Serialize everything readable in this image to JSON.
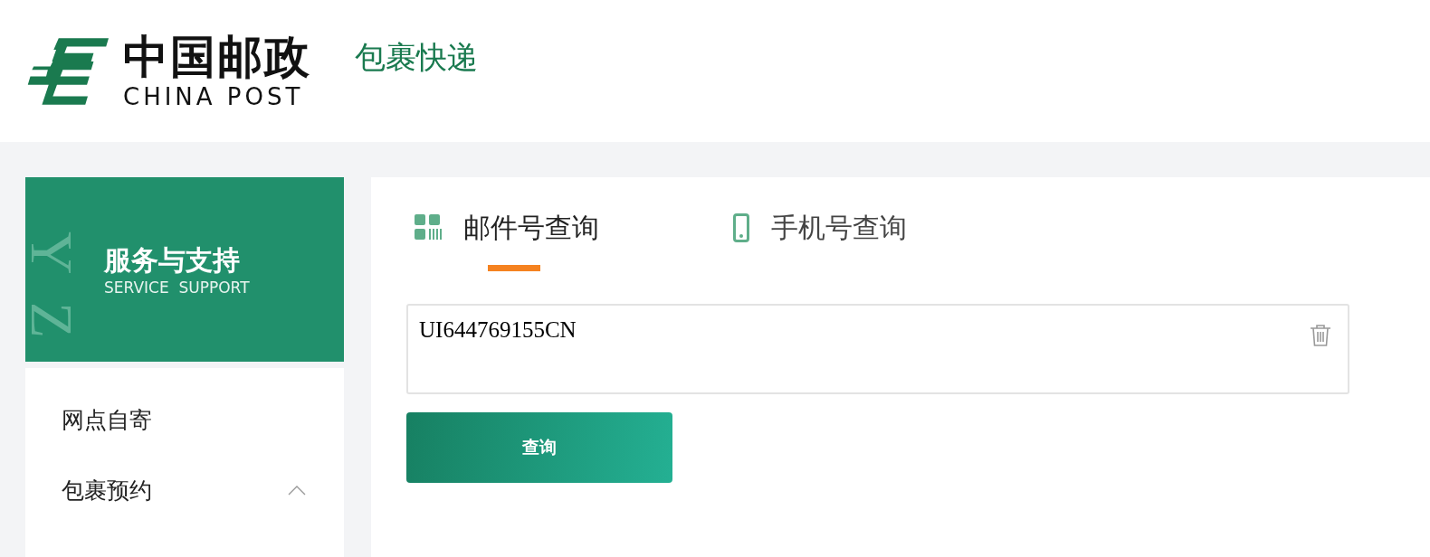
{
  "header": {
    "logo_cn": "中国邮政",
    "logo_en": "CHINA POST",
    "subtitle": "包裹快递"
  },
  "sidebar": {
    "banner": {
      "watermark": "YZ",
      "title": "服务与支持",
      "subtitle": "SERVICE  SUPPORT"
    },
    "items": [
      {
        "label": "网点自寄",
        "kind": "link"
      },
      {
        "label": "包裹预约",
        "kind": "group",
        "expanded": true
      }
    ]
  },
  "tabs": [
    {
      "label": "邮件号查询",
      "kind": "tracking",
      "selected": true
    },
    {
      "label": "手机号查询",
      "kind": "phone",
      "selected": false
    }
  ],
  "query": {
    "value": "UI644769155CN",
    "button": "查询"
  }
}
